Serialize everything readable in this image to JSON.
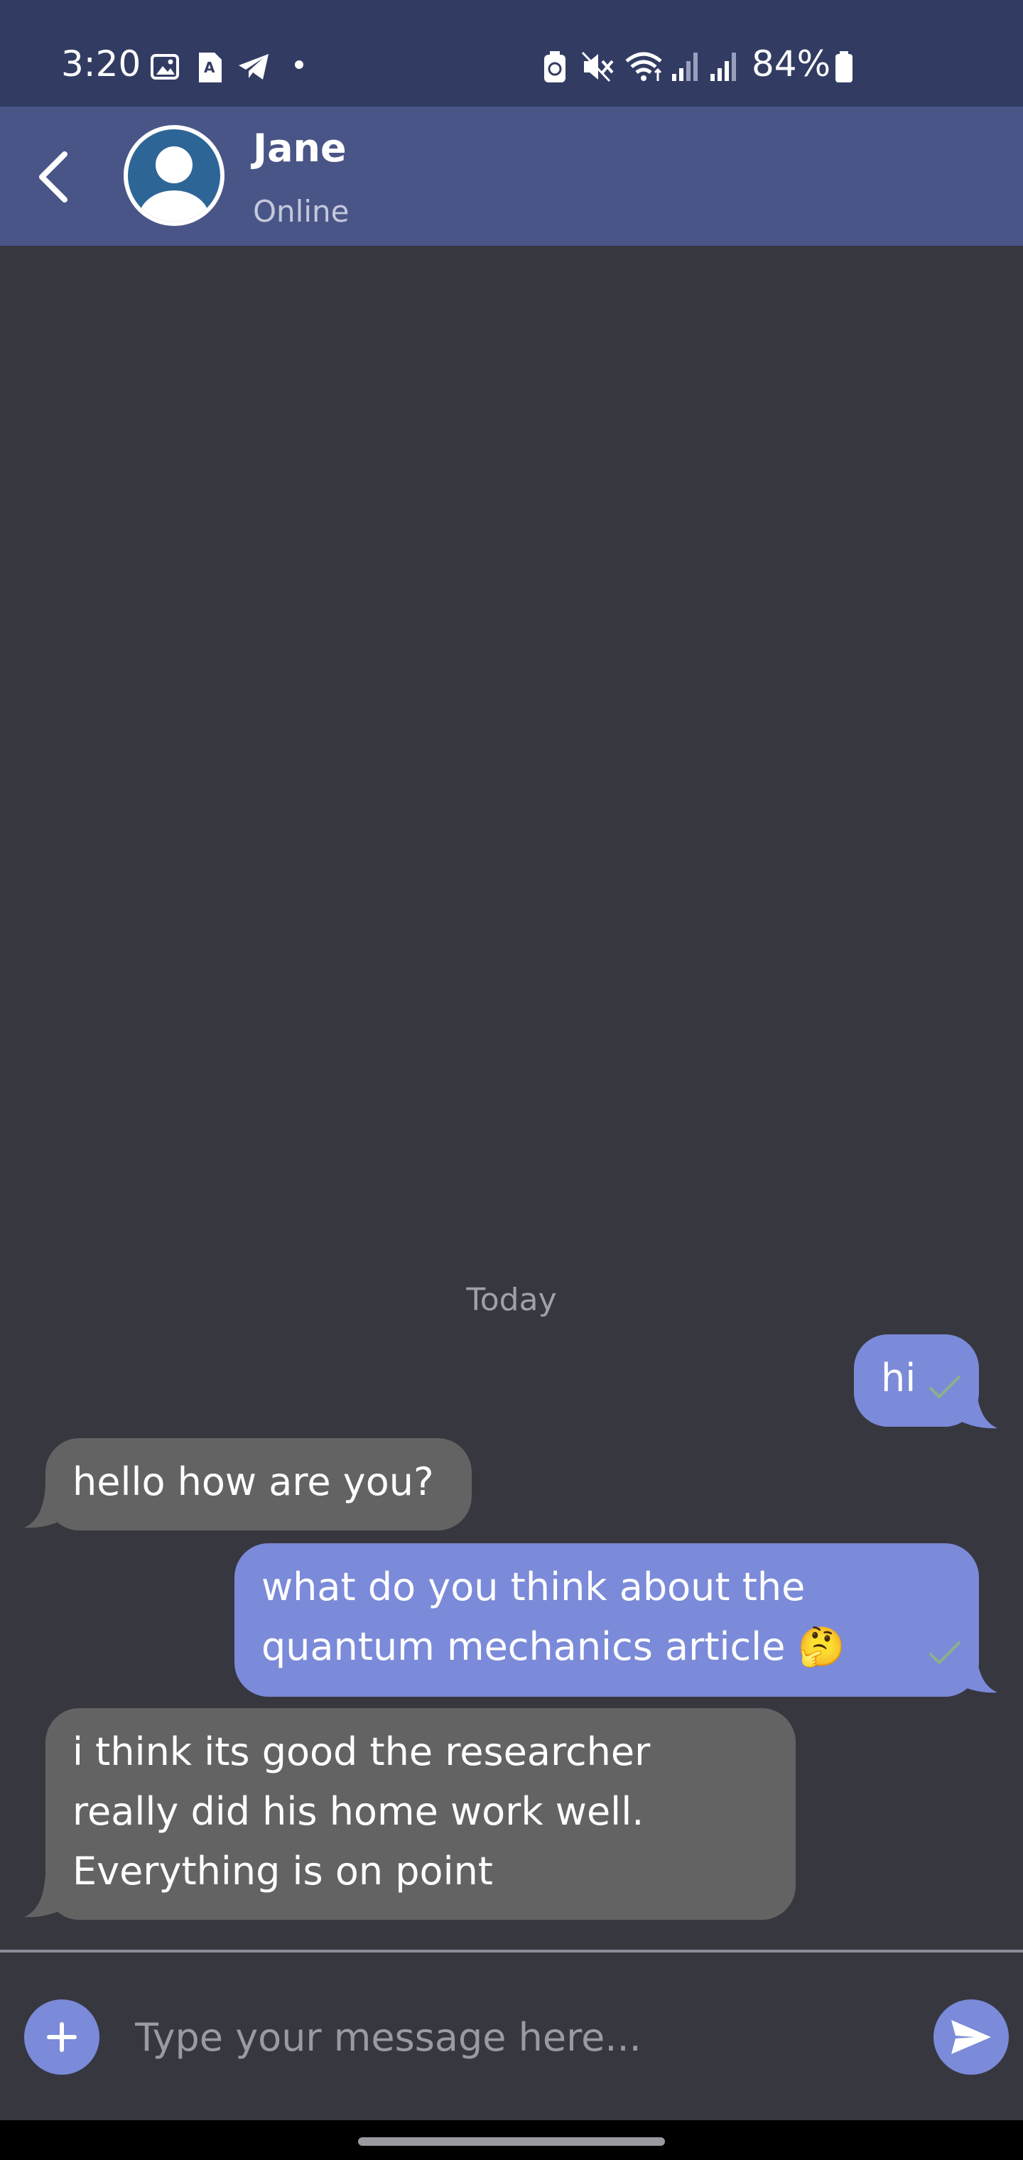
{
  "status_bar": {
    "time": "3:20",
    "battery": "84%",
    "left_icons": [
      "gallery-icon",
      "translate-icon",
      "telegram-icon",
      "dot-icon"
    ],
    "right_icons": [
      "battery-saver-icon",
      "mute-icon",
      "wifi-icon",
      "signal-icon",
      "signal-icon",
      "battery-icon"
    ]
  },
  "header": {
    "contact_name": "Jane",
    "contact_status": "Online",
    "back_icon": "chevron-left-icon",
    "avatar_icon": "user-avatar-icon"
  },
  "chat": {
    "date_label": "Today",
    "messages": [
      {
        "direction": "outgoing",
        "text": "hi",
        "status": "sent"
      },
      {
        "direction": "incoming",
        "text": "hello how are you?"
      },
      {
        "direction": "outgoing",
        "text": "what do you think about the\nquantum mechanics article 🤔",
        "status": "sent"
      },
      {
        "direction": "incoming",
        "text": "i think its good the researcher\nreally did his home work well.\nEverything is on point"
      }
    ]
  },
  "composer": {
    "placeholder": "Type your message here...",
    "value": "",
    "add_icon": "plus-icon",
    "send_icon": "send-icon"
  },
  "colors": {
    "status_bar": "#323c63",
    "header": "#4a5587",
    "background": "#373740",
    "outgoing_bubble": "#7b8ad9",
    "incoming_bubble": "#636363",
    "check": "#8fb08a"
  }
}
